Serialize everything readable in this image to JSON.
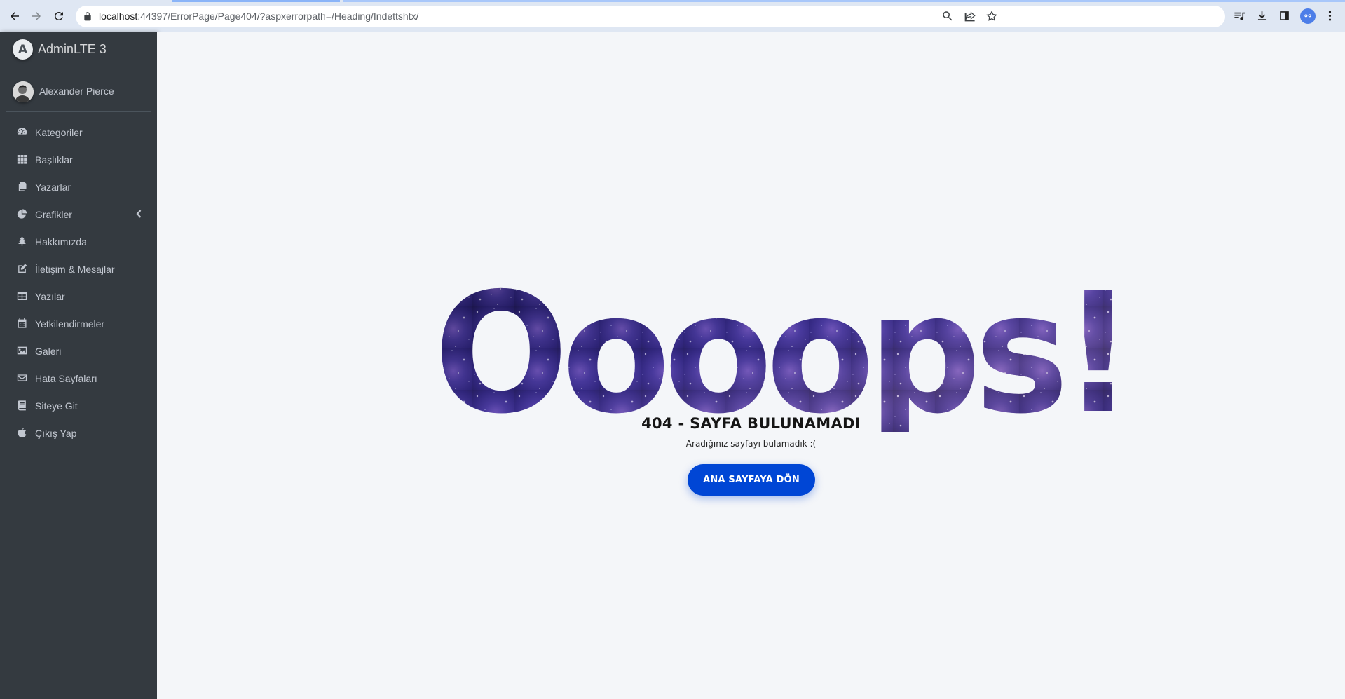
{
  "browser": {
    "url_host": "localhost",
    "url_rest": ":44397/ErrorPage/Page404/?aspxerrorpath=/Heading/Indettshtx/"
  },
  "sidebar": {
    "brand": "AdminLTE 3",
    "brand_logo": "A",
    "user_name": "Alexander Pierce",
    "items": [
      {
        "label": "Kategoriler",
        "icon": "tachometer-icon"
      },
      {
        "label": "Başlıklar",
        "icon": "th-icon"
      },
      {
        "label": "Yazarlar",
        "icon": "copy-icon"
      },
      {
        "label": "Grafikler",
        "icon": "chart-pie-icon",
        "has_children": true
      },
      {
        "label": "Hakkımızda",
        "icon": "tree-icon"
      },
      {
        "label": "İletişim & Mesajlar",
        "icon": "edit-icon"
      },
      {
        "label": "Yazılar",
        "icon": "table-icon"
      },
      {
        "label": "Yetkilendirmeler",
        "icon": "calendar-icon"
      },
      {
        "label": "Galeri",
        "icon": "image-icon"
      },
      {
        "label": "Hata Sayfaları",
        "icon": "envelope-icon"
      },
      {
        "label": "Siteye Git",
        "icon": "book-icon"
      },
      {
        "label": "Çıkış Yap",
        "icon": "apple-icon"
      }
    ]
  },
  "error": {
    "headline": "Oooops!",
    "title": "404 - SAYFA BULUNAMADI",
    "subtitle": "Aradığınız sayfayı bulamadık :(",
    "button_label": "ANA SAYFAYA DÖN"
  },
  "colors": {
    "sidebar_bg": "#343a40",
    "content_bg": "#f4f6f9",
    "button_bg": "#0046d5",
    "galaxy_dark": "#15113f",
    "galaxy_mid": "#4a3b9a"
  }
}
